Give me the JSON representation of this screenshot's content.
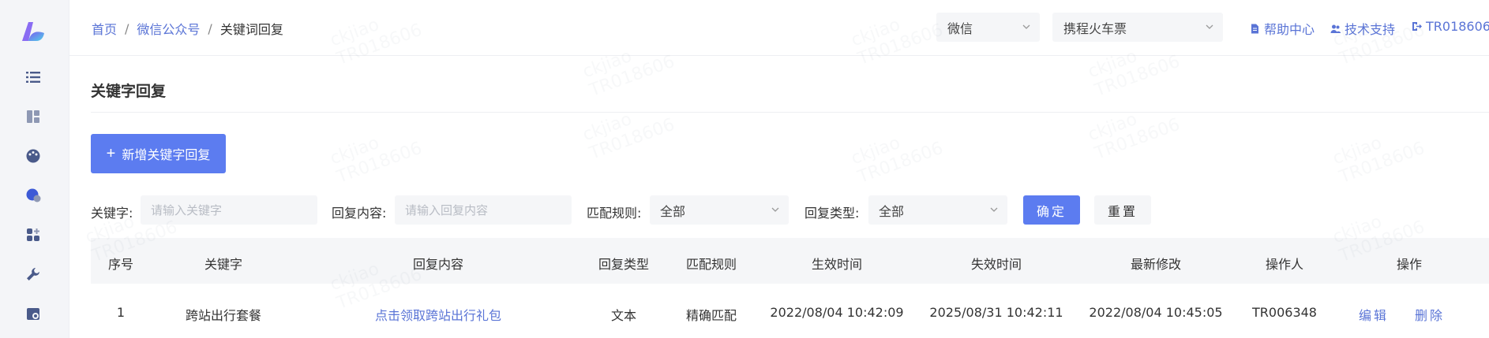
{
  "breadcrumb": {
    "home": "首页",
    "section": "微信公众号",
    "current": "关键词回复",
    "separator": "/"
  },
  "topbar": {
    "platform_select": "微信",
    "account_select": "携程火车票",
    "help": "帮助中心",
    "support": "技术支持",
    "user": "TR018606"
  },
  "sidebar": {
    "icons": [
      "logo-icon",
      "list-icon",
      "dashboard-icon",
      "palette-icon",
      "chat-icon",
      "apps-icon",
      "wrench-icon",
      "settings-icon"
    ]
  },
  "page": {
    "title": "关键字回复",
    "add_button": "新增关键字回复"
  },
  "filters": {
    "keyword_label": "关键字:",
    "keyword_placeholder": "请输入关键字",
    "content_label": "回复内容:",
    "content_placeholder": "请输入回复内容",
    "match_label": "匹配规则:",
    "match_value": "全部",
    "type_label": "回复类型:",
    "type_value": "全部",
    "confirm": "确定",
    "reset": "重置"
  },
  "table": {
    "headers": [
      "序号",
      "关键字",
      "回复内容",
      "回复类型",
      "匹配规则",
      "生效时间",
      "失效时间",
      "最新修改",
      "操作人",
      "操作"
    ],
    "rows": [
      {
        "index": "1",
        "keyword": "跨站出行套餐",
        "content": "点击领取跨站出行礼包",
        "type": "文本",
        "match": "精确匹配",
        "start": "2022/08/04 10:42:09",
        "end": "2025/08/31 10:42:11",
        "modified": "2022/08/04 10:45:05",
        "operator": "TR006348",
        "edit": "编辑",
        "delete": "删除"
      }
    ]
  },
  "watermark": [
    "ckjiao",
    "TR018606"
  ],
  "colors": {
    "primary": "#5c7cf0",
    "link": "#5a74d6",
    "sidebar_bg": "#f4f5f8",
    "input_bg": "#f5f6f8"
  }
}
